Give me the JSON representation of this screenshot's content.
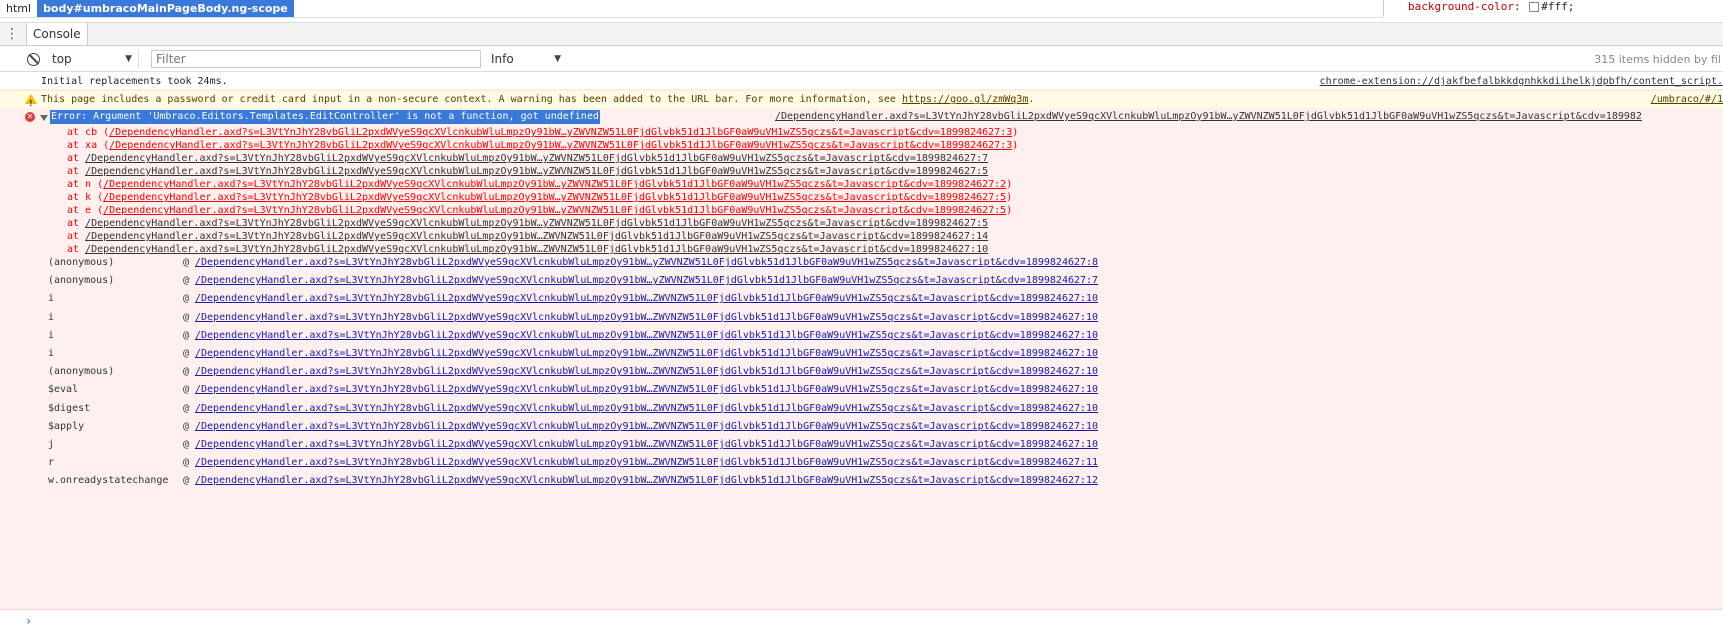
{
  "breadcrumbs": [
    {
      "label": "html"
    },
    {
      "label": "body#umbracoMainPageBody.ng-scope"
    }
  ],
  "styles": {
    "property": "background-color:",
    "value": "#fff;",
    "swatch_color": "#ffffff"
  },
  "tabs": {
    "console_label": "Console"
  },
  "toolbar": {
    "context": "top",
    "filter_placeholder": "Filter",
    "level": "Info",
    "hidden_count": "315 items hidden by fil"
  },
  "messages": {
    "info": {
      "text": "Initial replacements took 24ms.",
      "source": "chrome-extension://djakfbefalbkkdgnhkkdiihelkjdpbfh/content_script."
    },
    "warning": {
      "text": "This page includes a password or credit card input in a non-secure context. A warning has been added to the URL bar. For more information, see ",
      "link": "https://goo.gl/zmWq3m",
      "text_end": ".",
      "source": "/umbraco/#/1"
    },
    "error": {
      "headline": "Error: Argument 'Umbraco.Editors.Templates.EditController' is not a function, got undefined",
      "source": "/DependencyHandler.axd?s=L3VtYnJhY28vbGliL2pxdWVyeS9qcXVlcnkubWluLmpzOy91bW…yZWVNZW51L0FjdGlvbk51d1JlbGF0aW9uVH1wZS5qczs&t=Javascript&cdv=189982",
      "stack": [
        {
          "prefix": "at cb (",
          "link": "/DependencyHandler.axd?s=L3VtYnJhY28vbGliL2pxdWVyeS9qcXVlcnkubWluLmpzOy91bW…yZWVNZW51L0FjdGlvbk51d1JlbGF0aW9uVH1wZS5qczs&t=Javascript&cdv=1899824627:3",
          "suffix": ")"
        },
        {
          "prefix": "at xa (",
          "link": "/DependencyHandler.axd?s=L3VtYnJhY28vbGliL2pxdWVyeS9qcXVlcnkubWluLmpzOy91bW…yZWVNZW51L0FjdGlvbk51d1JlbGF0aW9uVH1wZS5qczs&t=Javascript&cdv=1899824627:3",
          "suffix": ")"
        },
        {
          "prefix": "at ",
          "link": "/DependencyHandler.axd?s=L3VtYnJhY28vbGliL2pxdWVyeS9qcXVlcnkubWluLmpzOy91bW…yZWVNZW51L0FjdGlvbk51d1JlbGF0aW9uVH1wZS5qczs&t=Javascript&cdv=1899824627:7",
          "suffix": ""
        },
        {
          "prefix": "at ",
          "link": "/DependencyHandler.axd?s=L3VtYnJhY28vbGliL2pxdWVyeS9qcXVlcnkubWluLmpzOy91bW…yZWVNZW51L0FjdGlvbk51d1JlbGF0aW9uVH1wZS5qczs&t=Javascript&cdv=1899824627:5",
          "suffix": ""
        },
        {
          "prefix": "at n (",
          "link": "/DependencyHandler.axd?s=L3VtYnJhY28vbGliL2pxdWVyeS9qcXVlcnkubWluLmpzOy91bW…yZWVNZW51L0FjdGlvbk51d1JlbGF0aW9uVH1wZS5qczs&t=Javascript&cdv=1899824627:2",
          "suffix": ")"
        },
        {
          "prefix": "at k (",
          "link": "/DependencyHandler.axd?s=L3VtYnJhY28vbGliL2pxdWVyeS9qcXVlcnkubWluLmpzOy91bW…yZWVNZW51L0FjdGlvbk51d1JlbGF0aW9uVH1wZS5qczs&t=Javascript&cdv=1899824627:5",
          "suffix": ")"
        },
        {
          "prefix": "at e (",
          "link": "/DependencyHandler.axd?s=L3VtYnJhY28vbGliL2pxdWVyeS9qcXVlcnkubWluLmpzOy91bW…yZWVNZW51L0FjdGlvbk51d1JlbGF0aW9uVH1wZS5qczs&t=Javascript&cdv=1899824627:5",
          "suffix": ")"
        },
        {
          "prefix": "at ",
          "link": "/DependencyHandler.axd?s=L3VtYnJhY28vbGliL2pxdWVyeS9qcXVlcnkubWluLmpzOy91bW…yZWVNZW51L0FjdGlvbk51d1JlbGF0aW9uVH1wZS5qczs&t=Javascript&cdv=1899824627:5",
          "suffix": ""
        },
        {
          "prefix": "at ",
          "link": "/DependencyHandler.axd?s=L3VtYnJhY28vbGliL2pxdWVyeS9qcXVlcnkubWluLmpzOy91bW…ZWVNZW51L0FjdGlvbk51d1JlbGF0aW9uVH1wZS5qczs&t=Javascript&cdv=1899824627:14",
          "suffix": ""
        },
        {
          "prefix": "at ",
          "link": "/DependencyHandler.axd?s=L3VtYnJhY28vbGliL2pxdWVyeS9qcXVlcnkubWluLmpzOy91bW…ZWVNZW51L0FjdGlvbk51d1JlbGF0aW9uVH1wZS5qczs&t=Javascript&cdv=1899824627:10",
          "suffix": ""
        }
      ],
      "frames": [
        {
          "name": "(anonymous)",
          "link": "/DependencyHandler.axd?s=L3VtYnJhY28vbGliL2pxdWVyeS9qcXVlcnkubWluLmpzOy91bW…yZWVNZW51L0FjdGlvbk51d1JlbGF0aW9uVH1wZS5qczs&t=Javascript&cdv=1899824627:8"
        },
        {
          "name": "(anonymous)",
          "link": "/DependencyHandler.axd?s=L3VtYnJhY28vbGliL2pxdWVyeS9qcXVlcnkubWluLmpzOy91bW…yZWVNZW51L0FjdGlvbk51d1JlbGF0aW9uVH1wZS5qczs&t=Javascript&cdv=1899824627:7"
        },
        {
          "name": "i",
          "link": "/DependencyHandler.axd?s=L3VtYnJhY28vbGliL2pxdWVyeS9qcXVlcnkubWluLmpzOy91bW…ZWVNZW51L0FjdGlvbk51d1JlbGF0aW9uVH1wZS5qczs&t=Javascript&cdv=1899824627:10"
        },
        {
          "name": "i",
          "link": "/DependencyHandler.axd?s=L3VtYnJhY28vbGliL2pxdWVyeS9qcXVlcnkubWluLmpzOy91bW…ZWVNZW51L0FjdGlvbk51d1JlbGF0aW9uVH1wZS5qczs&t=Javascript&cdv=1899824627:10"
        },
        {
          "name": "i",
          "link": "/DependencyHandler.axd?s=L3VtYnJhY28vbGliL2pxdWVyeS9qcXVlcnkubWluLmpzOy91bW…ZWVNZW51L0FjdGlvbk51d1JlbGF0aW9uVH1wZS5qczs&t=Javascript&cdv=1899824627:10"
        },
        {
          "name": "i",
          "link": "/DependencyHandler.axd?s=L3VtYnJhY28vbGliL2pxdWVyeS9qcXVlcnkubWluLmpzOy91bW…ZWVNZW51L0FjdGlvbk51d1JlbGF0aW9uVH1wZS5qczs&t=Javascript&cdv=1899824627:10"
        },
        {
          "name": "(anonymous)",
          "link": "/DependencyHandler.axd?s=L3VtYnJhY28vbGliL2pxdWVyeS9qcXVlcnkubWluLmpzOy91bW…ZWVNZW51L0FjdGlvbk51d1JlbGF0aW9uVH1wZS5qczs&t=Javascript&cdv=1899824627:10"
        },
        {
          "name": "$eval",
          "link": "/DependencyHandler.axd?s=L3VtYnJhY28vbGliL2pxdWVyeS9qcXVlcnkubWluLmpzOy91bW…ZWVNZW51L0FjdGlvbk51d1JlbGF0aW9uVH1wZS5qczs&t=Javascript&cdv=1899824627:10"
        },
        {
          "name": "$digest",
          "link": "/DependencyHandler.axd?s=L3VtYnJhY28vbGliL2pxdWVyeS9qcXVlcnkubWluLmpzOy91bW…ZWVNZW51L0FjdGlvbk51d1JlbGF0aW9uVH1wZS5qczs&t=Javascript&cdv=1899824627:10"
        },
        {
          "name": "$apply",
          "link": "/DependencyHandler.axd?s=L3VtYnJhY28vbGliL2pxdWVyeS9qcXVlcnkubWluLmpzOy91bW…ZWVNZW51L0FjdGlvbk51d1JlbGF0aW9uVH1wZS5qczs&t=Javascript&cdv=1899824627:10"
        },
        {
          "name": "j",
          "link": "/DependencyHandler.axd?s=L3VtYnJhY28vbGliL2pxdWVyeS9qcXVlcnkubWluLmpzOy91bW…ZWVNZW51L0FjdGlvbk51d1JlbGF0aW9uVH1wZS5qczs&t=Javascript&cdv=1899824627:10"
        },
        {
          "name": "r",
          "link": "/DependencyHandler.axd?s=L3VtYnJhY28vbGliL2pxdWVyeS9qcXVlcnkubWluLmpzOy91bW…ZWVNZW51L0FjdGlvbk51d1JlbGF0aW9uVH1wZS5qczs&t=Javascript&cdv=1899824627:11"
        },
        {
          "name": "w.onreadystatechange",
          "link": "/DependencyHandler.axd?s=L3VtYnJhY28vbGliL2pxdWVyeS9qcXVlcnkubWluLmpzOy91bW…ZWVNZW51L0FjdGlvbk51d1JlbGF0aW9uVH1wZS5qczs&t=Javascript&cdv=1899824627:12"
        }
      ]
    }
  },
  "prompt": {
    "symbol": "›"
  },
  "icons": {
    "clear": "block-icon",
    "warning": "warning-icon",
    "error": "error-icon",
    "menu": "kebab-icon"
  }
}
